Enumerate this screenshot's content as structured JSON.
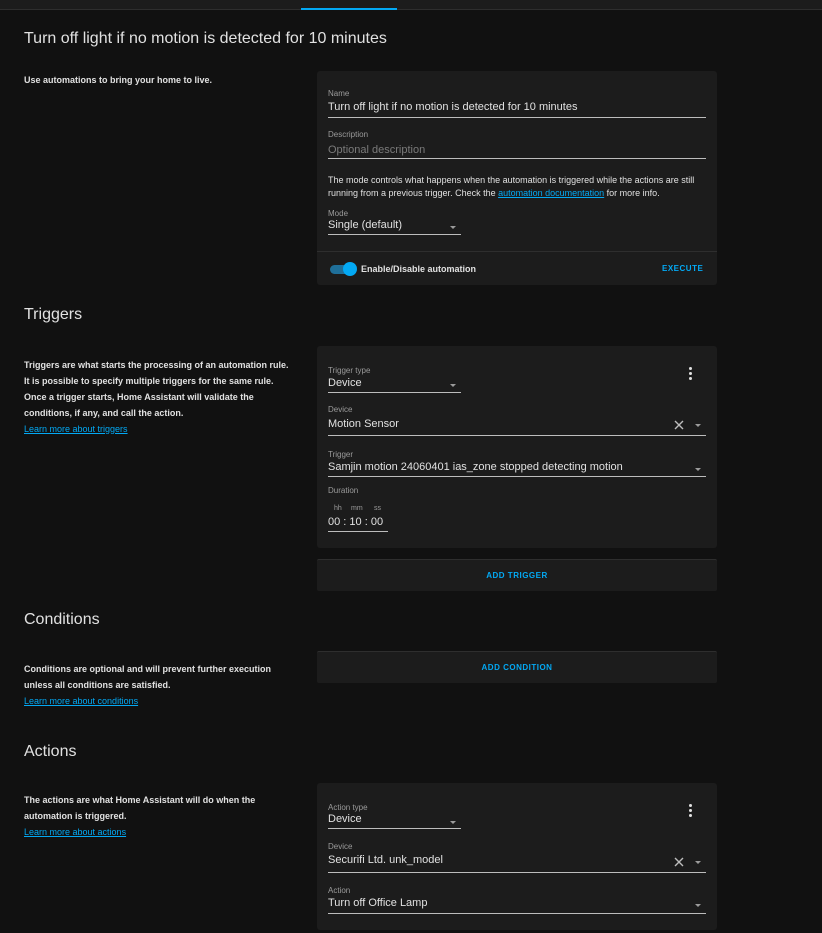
{
  "page": {
    "title": "Turn off light if no motion is detected for 10 minutes",
    "intro": "Use automations to bring your home to live."
  },
  "automation": {
    "name_label": "Name",
    "name_value": "Turn off light if no motion is detected for 10 minutes",
    "description_label": "Description",
    "description_placeholder": "Optional description",
    "mode_desc_before": "The mode controls what happens when the automation is triggered while the actions are still running from a previous trigger. Check the ",
    "mode_desc_link": "automation documentation",
    "mode_desc_after": " for more info.",
    "mode_label": "Mode",
    "mode_value": "Single (default)",
    "toggle_label": "Enable/Disable automation",
    "toggle_on": true,
    "execute_label": "EXECUTE"
  },
  "triggers": {
    "title": "Triggers",
    "description": "Triggers are what starts the processing of an automation rule. It is possible to specify multiple triggers for the same rule. Once a trigger starts, Home Assistant will validate the conditions, if any, and call the action.",
    "learn_more": "Learn more about triggers",
    "type_label": "Trigger type",
    "type_value": "Device",
    "device_label": "Device",
    "device_value": "Motion Sensor",
    "trigger_label": "Trigger",
    "trigger_value": "Samjin motion 24060401 ias_zone stopped detecting motion",
    "duration_label": "Duration",
    "duration_hh_label": "hh",
    "duration_mm_label": "mm",
    "duration_ss_label": "ss",
    "duration_hh": "00",
    "duration_mm": "10",
    "duration_ss": "00",
    "add_label": "ADD TRIGGER"
  },
  "conditions": {
    "title": "Conditions",
    "description": "Conditions are optional and will prevent further execution unless all conditions are satisfied.",
    "learn_more": "Learn more about conditions",
    "add_label": "ADD CONDITION"
  },
  "actions": {
    "title": "Actions",
    "description": "The actions are what Home Assistant will do when the automation is triggered.",
    "learn_more": "Learn more about actions",
    "type_label": "Action type",
    "type_value": "Device",
    "device_label": "Device",
    "device_value": "Securifi Ltd. unk_model",
    "action_label": "Action",
    "action_value": "Turn off Office Lamp"
  },
  "colors": {
    "accent": "#03a9f4",
    "background": "#111111",
    "card": "#1c1c1c"
  }
}
